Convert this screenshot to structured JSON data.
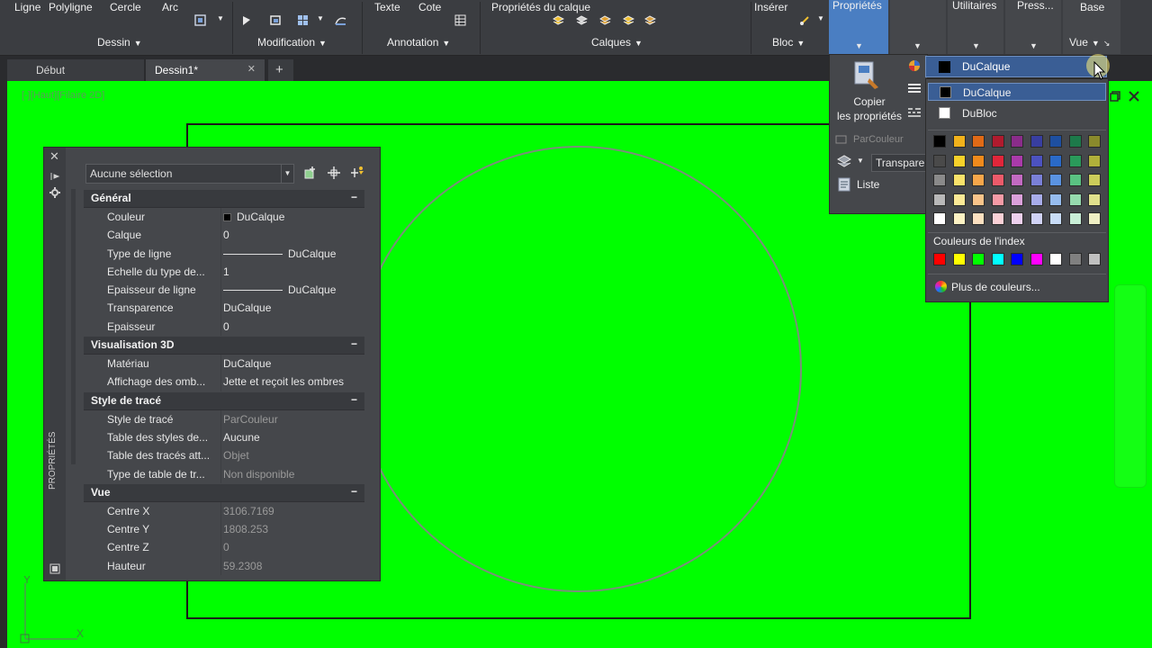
{
  "ribbon": {
    "tools": {
      "ligne": "Ligne",
      "polyligne": "Polyligne",
      "cercle": "Cercle",
      "arc": "Arc",
      "texte": "Texte",
      "cote": "Cote",
      "proprietes_calque": "Propriétés\ndu calque",
      "inserer": "Insérer"
    },
    "panels": {
      "dessin": "Dessin",
      "modification": "Modification",
      "annotation": "Annotation",
      "calques": "Calques",
      "bloc": "Bloc",
      "vue": "Vue"
    },
    "tabs": {
      "proprietes": "Propriétés",
      "utilitaires": "Utilitaires",
      "presse": "Press...",
      "base": "Base"
    },
    "caret": "▼",
    "vue_pin": "↘"
  },
  "doc_tabs": {
    "debut": "Début",
    "dessin1": "Dessin1*",
    "close": "✕",
    "add": "+"
  },
  "viewport": {
    "label": "[-][Haut][Filaire 2D]",
    "ucs_y": "Y",
    "ucs_x": "X"
  },
  "palette": {
    "selection": "Aucune sélection",
    "side_title": "PROPRIÉTÉS",
    "close": "✕",
    "sections": {
      "general": {
        "title": "Général",
        "toggle": "−",
        "rows": [
          {
            "k": "Couleur",
            "v": "DuCalque"
          },
          {
            "k": "Calque",
            "v": "0"
          },
          {
            "k": "Type de ligne",
            "v": "DuCalque"
          },
          {
            "k": "Echelle du type de...",
            "v": "1"
          },
          {
            "k": "Epaisseur de ligne",
            "v": "DuCalque"
          },
          {
            "k": "Transparence",
            "v": "DuCalque"
          },
          {
            "k": "Epaisseur",
            "v": "0"
          }
        ]
      },
      "visualisation": {
        "title": "Visualisation 3D",
        "toggle": "−",
        "rows": [
          {
            "k": "Matériau",
            "v": "DuCalque"
          },
          {
            "k": "Affichage des omb...",
            "v": "Jette et reçoit les ombres"
          }
        ]
      },
      "style": {
        "title": "Style de tracé",
        "toggle": "−",
        "rows": [
          {
            "k": "Style de tracé",
            "v": "ParCouleur"
          },
          {
            "k": "Table des styles de...",
            "v": "Aucune"
          },
          {
            "k": "Table des tracés att...",
            "v": "Objet"
          },
          {
            "k": "Type de table de tr...",
            "v": "Non disponible"
          }
        ]
      },
      "vue": {
        "title": "Vue",
        "toggle": "−",
        "rows": [
          {
            "k": "Centre X",
            "v": "3106.7169"
          },
          {
            "k": "Centre Y",
            "v": "1808.253"
          },
          {
            "k": "Centre Z",
            "v": "0"
          },
          {
            "k": "Hauteur",
            "v": "59.2308"
          }
        ]
      }
    }
  },
  "props_panel": {
    "copy_label": "Copier\nles propriétés",
    "parcouleur": "ParCouleur",
    "transparence": "Transparence",
    "liste": "Liste"
  },
  "color_dropdown": {
    "current": "DuCalque",
    "options": [
      "DuCalque",
      "DuBloc"
    ],
    "index_title": "Couleurs de l'index",
    "more": "Plus de couleurs...",
    "grid_colors": [
      [
        "#000000",
        "#f2b21b",
        "#e06a16",
        "#b01b2e",
        "#8a2c8a",
        "#383ea0",
        "#1e4fa0",
        "#1d7a4a",
        "#8a8a2c"
      ],
      [
        "#4a4a4a",
        "#f7d12a",
        "#f08a1c",
        "#e0263a",
        "#aa3aaa",
        "#4c52c0",
        "#2a6ac8",
        "#2a9a5a",
        "#b0b03a"
      ],
      [
        "#8a8a8a",
        "#f9e26a",
        "#f6a64a",
        "#ec5a6a",
        "#c26ac2",
        "#7a80d8",
        "#5a92e0",
        "#5ac282",
        "#cccc5a"
      ],
      [
        "#b8b8b8",
        "#fbe996",
        "#f9c48a",
        "#f59aa6",
        "#dba0db",
        "#a8acea",
        "#96bcef",
        "#96dbae",
        "#e0e08c"
      ],
      [
        "#ffffff",
        "#fdf2c4",
        "#fce0c0",
        "#fad0d6",
        "#edd0ed",
        "#d0d2f5",
        "#c8dcf7",
        "#c8eed6",
        "#efefc4"
      ]
    ],
    "index_colors": [
      "#ff0000",
      "#ffff00",
      "#00ff00",
      "#00ffff",
      "#0000ff",
      "#ff00ff",
      "#ffffff",
      "#808080",
      "#c0c0c0"
    ]
  }
}
